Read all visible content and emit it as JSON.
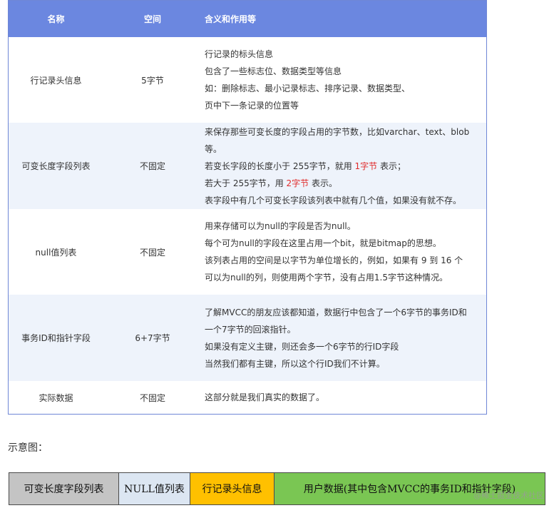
{
  "table": {
    "headers": [
      "名称",
      "空间",
      "含义和作用等"
    ],
    "rows": [
      {
        "name": "行记录头信息",
        "space": "5字节",
        "lines": [
          "行记录的标头信息",
          "包含了一些标志位、数据类型等信息",
          "如：删除标志、最小记录标志、排序记录、数据类型、",
          "页中下一条记录的位置等"
        ]
      },
      {
        "name": "可变长度字段列表",
        "space": "不固定",
        "lines": [
          "来保存那些可变长度的字段占用的字节数，比如varchar、text、blob等。",
          {
            "before": "若变长字段的长度小于 255字节，就用 ",
            "highlight": "1字节",
            "after": " 表示；"
          },
          {
            "before": "若大于 255字节，用 ",
            "highlight": "2字节",
            "after": " 表示。"
          },
          "表字段中有几个可变长字段该列表中就有几个值，如果没有就不存。"
        ]
      },
      {
        "name": "null值列表",
        "space": "不固定",
        "lines": [
          "用来存储可以为null的字段是否为null。",
          "每个可为null的字段在这里占用一个bit，就是bitmap的思想。",
          "该列表占用的空间是以字节为单位增长的，例如，如果有 9 到 16 个",
          "可以为null的列，则使用两个字节，没有占用1.5字节这种情况。"
        ]
      },
      {
        "name": "事务ID和指针字段",
        "space": "6+7字节",
        "lines": [
          "了解MVCC的朋友应该都知道，数据行中包含了一个6字节的事务ID和",
          "一个7字节的回滚指针。",
          "如果没有定义主键，则还会多一个6字节的行ID字段",
          "当然我们都有主键，所以这个行ID我们不计算。"
        ]
      },
      {
        "name": "实际数据",
        "space": "不固定",
        "lines": [
          "这部分就是我们真实的数据了。"
        ]
      }
    ]
  },
  "caption": "示意图：",
  "diagram": {
    "segments": [
      "可变长度字段列表",
      "NULL值列表",
      "行记录头信息",
      "用户数据(其中包含MVCC的事务ID和指针字段)"
    ]
  },
  "watermark": "@稀土掘金技术社区",
  "colors": {
    "header_bg": "#6b87e0",
    "alt_row_bg": "#eef3fb",
    "highlight_text": "#e02b2b",
    "seg_gray": "#c4c4c4",
    "seg_lightblue": "#dce6f2",
    "seg_orange": "#ffc000",
    "seg_green": "#7ac653"
  }
}
